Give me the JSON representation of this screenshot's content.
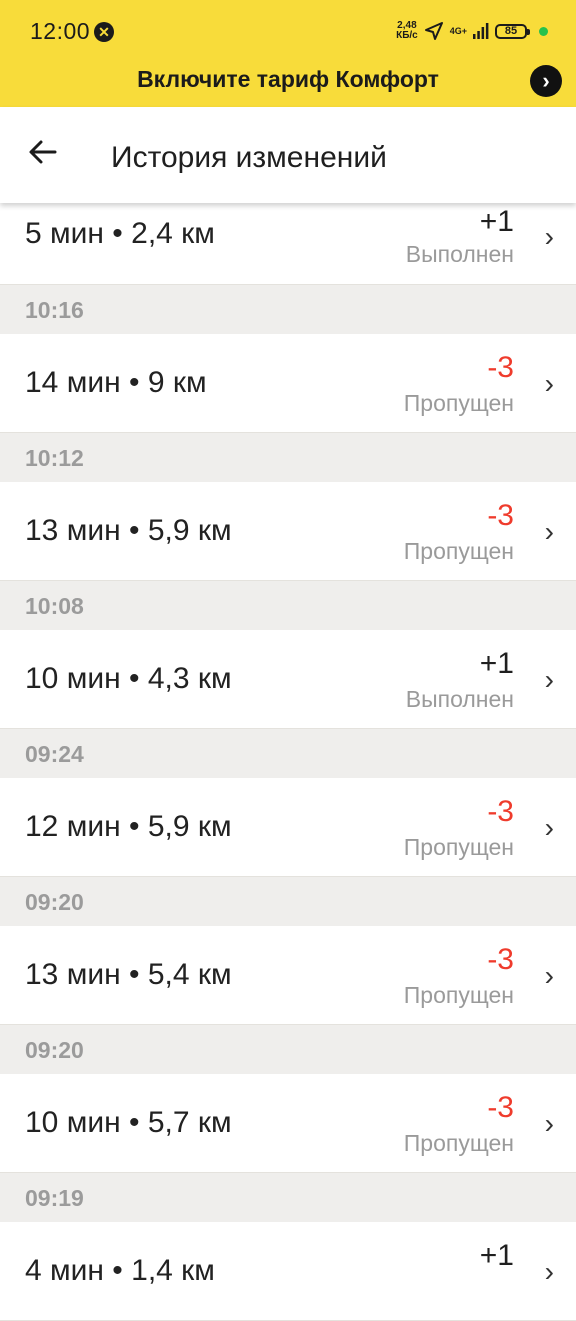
{
  "status_bar": {
    "time": "12:00",
    "speed_top": "2,48",
    "speed_unit": "КБ/с",
    "network": "4G+",
    "battery": "85"
  },
  "promo": {
    "text": "Включите тариф Комфорт"
  },
  "header": {
    "title": "История изменений"
  },
  "rows": [
    {
      "main": "5 мин • 2,4 км",
      "score": "+1",
      "status": "Выполнен"
    },
    {
      "main": "14 мин • 9 км",
      "score": "-3",
      "status": "Пропущен"
    },
    {
      "main": "13 мин • 5,9 км",
      "score": "-3",
      "status": "Пропущен"
    },
    {
      "main": "10 мин • 4,3 км",
      "score": "+1",
      "status": "Выполнен"
    },
    {
      "main": "12 мин • 5,9 км",
      "score": "-3",
      "status": "Пропущен"
    },
    {
      "main": "13 мин • 5,4 км",
      "score": "-3",
      "status": "Пропущен"
    },
    {
      "main": "10 мин • 5,7 км",
      "score": "-3",
      "status": "Пропущен"
    },
    {
      "main": "4 мин • 1,4 км",
      "score": "+1",
      "status": ""
    }
  ],
  "separators": [
    "10:16",
    "10:12",
    "10:08",
    "09:24",
    "09:20",
    "09:20",
    "09:19"
  ],
  "colors": {
    "accent": "#f8dc3a",
    "negative": "#ef3b2c"
  }
}
